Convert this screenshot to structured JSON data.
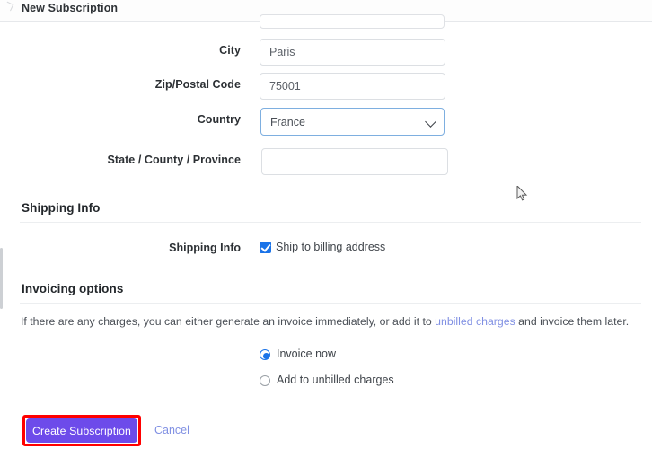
{
  "header": {
    "title": "New Subscription"
  },
  "billing_fields": [
    {
      "label": "City",
      "value": "Paris",
      "type": "text",
      "name": "city"
    },
    {
      "label": "Zip/Postal Code",
      "value": "75001",
      "type": "text",
      "name": "zip"
    },
    {
      "label": "Country",
      "value": "France",
      "type": "select",
      "name": "country",
      "options": [
        "France"
      ]
    },
    {
      "label": "State / County / Province",
      "value": "",
      "type": "text",
      "name": "state"
    }
  ],
  "shipping": {
    "section_title": "Shipping Info",
    "row_label": "Shipping Info",
    "checkbox_label": "Ship to billing address",
    "checked": true
  },
  "invoicing": {
    "section_title": "Invoicing options",
    "description_before": "If there are any charges, you can either generate an invoice immediately, or add it to ",
    "link_text": "unbilled charges",
    "description_after": " and invoice them later.",
    "options": [
      {
        "label": "Invoice now",
        "selected": true
      },
      {
        "label": "Add to unbilled charges",
        "selected": false
      }
    ]
  },
  "footer": {
    "submit_label": "Create Subscription",
    "cancel_label": "Cancel"
  },
  "colors": {
    "brand_purple": "#6d4bea",
    "accent_blue": "#1a73e8",
    "link_blue": "#8090e3",
    "annotation_red": "#ff0000",
    "focus_border": "#7eafe0"
  }
}
